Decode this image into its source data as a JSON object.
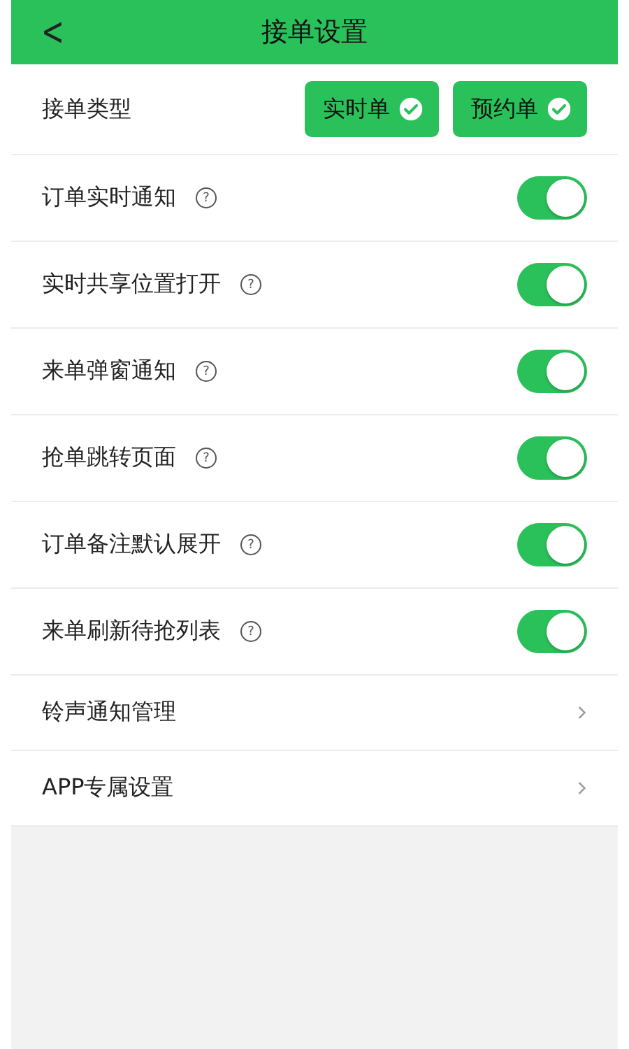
{
  "header": {
    "back": "<",
    "title": "接单设置"
  },
  "order_type": {
    "label": "接单类型",
    "options": [
      {
        "label": "实时单",
        "selected": true
      },
      {
        "label": "预约单",
        "selected": true
      }
    ]
  },
  "settings": [
    {
      "kind": "toggle",
      "label": "订单实时通知",
      "help": "?",
      "on": true
    },
    {
      "kind": "toggle",
      "label": "实时共享位置打开",
      "help": "?",
      "on": true
    },
    {
      "kind": "toggle",
      "label": "来单弹窗通知",
      "help": "?",
      "on": true
    },
    {
      "kind": "toggle",
      "label": "抢单跳转页面",
      "help": "?",
      "on": true
    },
    {
      "kind": "toggle",
      "label": "订单备注默认展开",
      "help": "?",
      "on": true
    },
    {
      "kind": "toggle",
      "label": "来单刷新待抢列表",
      "help": "?",
      "on": true
    },
    {
      "kind": "link",
      "label": "铃声通知管理"
    },
    {
      "kind": "link",
      "label": "APP专属设置"
    }
  ]
}
